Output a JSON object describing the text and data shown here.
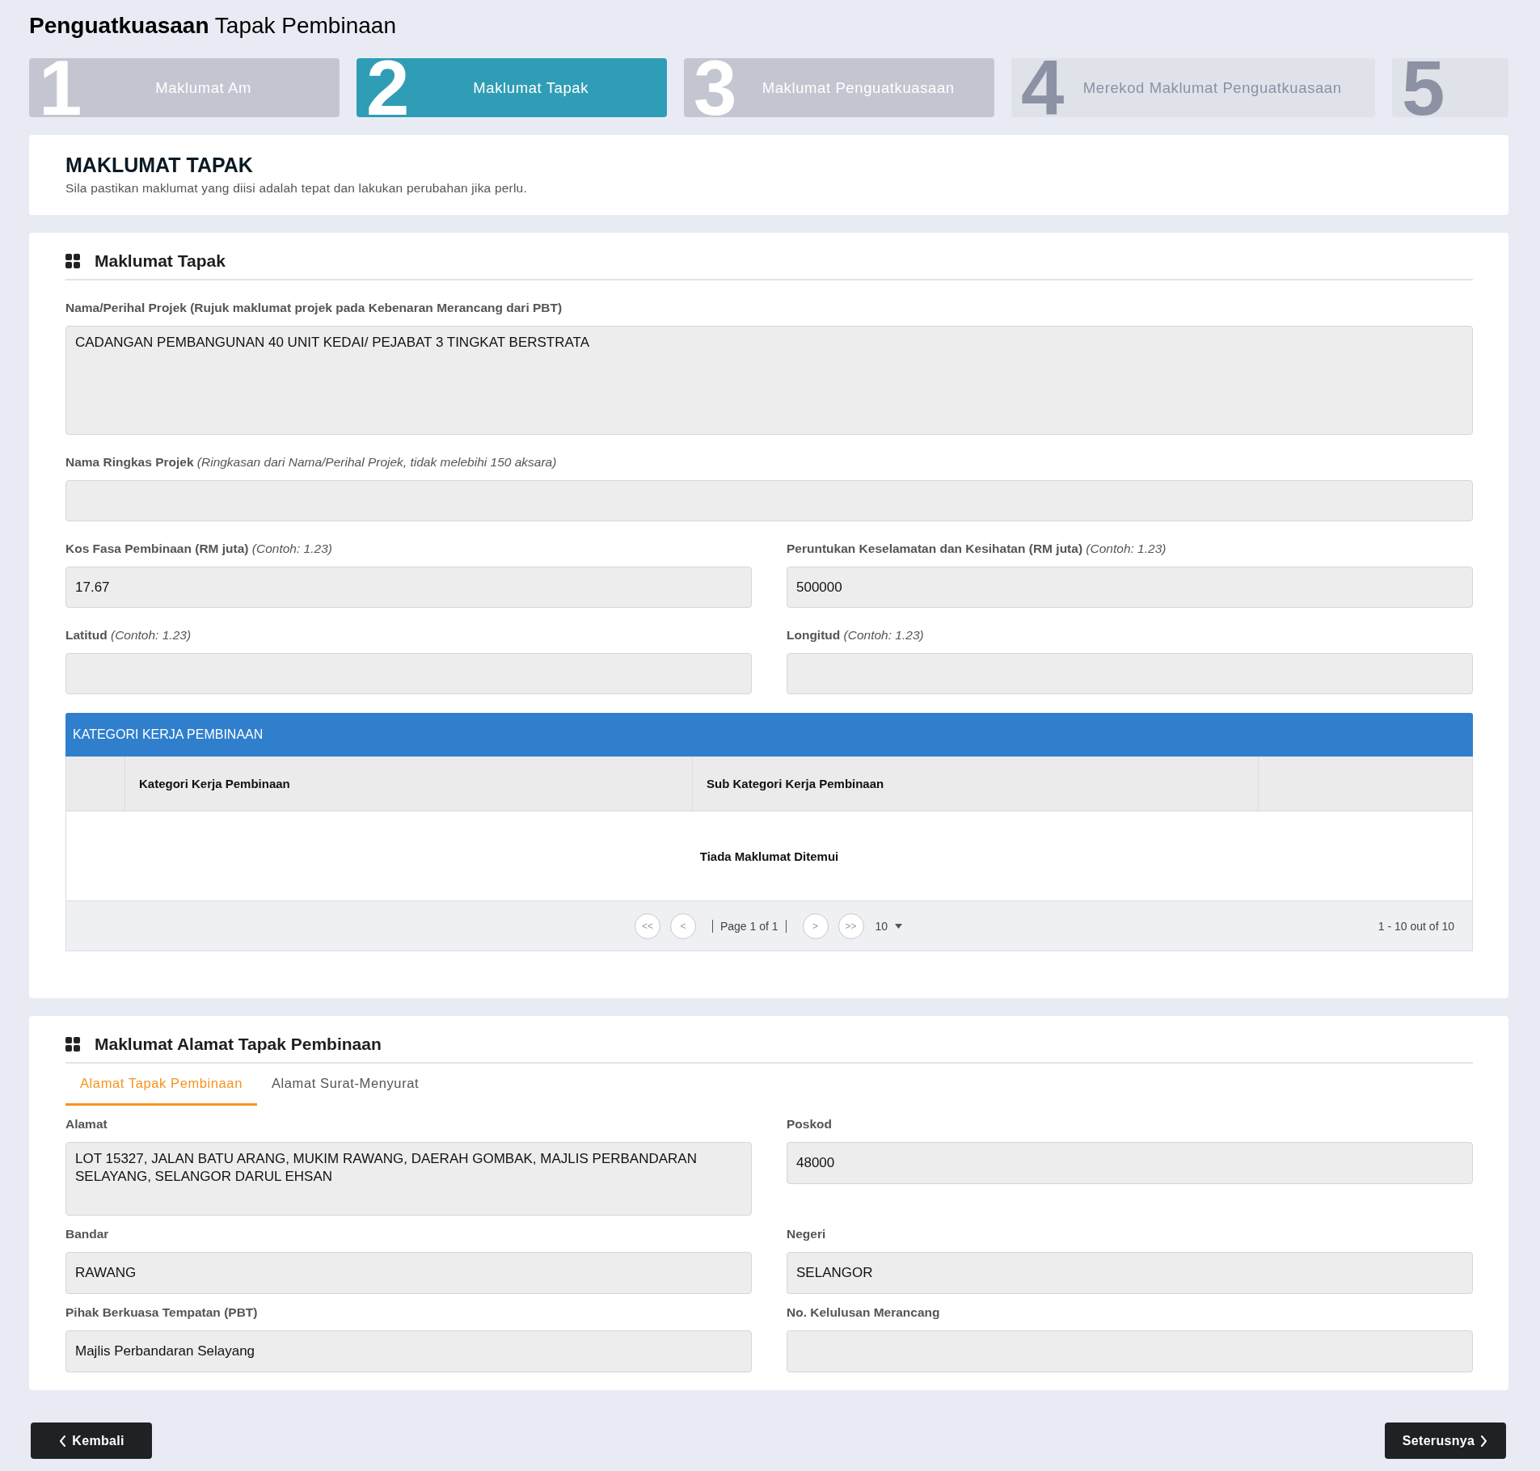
{
  "page_title": "**Penguatkuasaan** Tapak Pembinaan",
  "steps": [
    {
      "number": "1",
      "label": "Maklumat Am",
      "selected": false,
      "disabled": false
    },
    {
      "number": "2",
      "label": "Maklumat Tapak",
      "selected": true,
      "disabled": false
    },
    {
      "number": "3",
      "label": "Maklumat Penguatkuasaan",
      "selected": false,
      "disabled": false
    },
    {
      "number": "4",
      "label": "Merekod Maklumat Penguatkuasaan",
      "selected": false,
      "disabled": true
    },
    {
      "number": "5",
      "selected": false,
      "disabled": true
    }
  ],
  "intro": {
    "title": "MAKLUMAT TAPAK",
    "subtitle": "Sila pastikan maklumat yang diisi adalah tepat dan lakukan perubahan jika perlu."
  },
  "site_section": {
    "heading": "Maklumat Tapak",
    "rows": [
      [
        {
          "label": "Nama/Perihal Projek (Rujuk maklumat projek pada Kebenaran Merancang dari PBT)",
          "kind": "textarea",
          "value": "CADANGAN PEMBANGUNAN 40 UNIT KEDAI/ PEJABAT 3 TINGKAT BERSTRATA"
        }
      ],
      [
        {
          "label": "Nama Ringkas Projek *(Ringkasan dari Nama/Perihal Projek, tidak melebihi 150 aksara)*",
          "kind": "text"
        }
      ],
      [
        {
          "label": "Kos Fasa Pembinaan (RM juta) *(Contoh: 1.23)*",
          "kind": "text",
          "value": "17.67"
        },
        {
          "label": "Peruntukan Keselamatan dan Kesihatan (RM juta) *(Contoh: 1.23)*",
          "kind": "text",
          "value": "500000"
        }
      ],
      [
        {
          "label": "Latitud *(Contoh: 1.23)*",
          "kind": "text"
        },
        {
          "label": "Longitud *(Contoh: 1.23)*",
          "kind": "text"
        }
      ]
    ],
    "table": {
      "title": "KATEGORI KERJA PEMBINAAN",
      "columns": [
        {
          "kind": "blank"
        },
        {
          "kind": "text",
          "label": "Kategori Kerja Pembinaan"
        },
        {
          "kind": "text",
          "label": "Sub Kategori Kerja Pembinaan"
        },
        {
          "kind": "blank"
        }
      ],
      "empty_message": "Tiada Maklumat Ditemui",
      "pagination": {
        "first": "<<",
        "previous": "<",
        "page": "Page 1 of 1",
        "next": ">",
        "last": ">>",
        "page_size": "10",
        "summary": "1 - 10 out of 10"
      }
    }
  },
  "address_section": {
    "heading": "Maklumat Alamat Tapak Pembinaan",
    "tabs": [
      {
        "label": "Alamat Tapak Pembinaan",
        "selected": true
      },
      {
        "label": "Alamat Surat-Menyurat",
        "selected": false
      }
    ],
    "rows": [
      [
        {
          "label": "Alamat",
          "kind": "textarea",
          "value": "LOT 15327, JALAN BATU ARANG, MUKIM RAWANG, DAERAH GOMBAK, MAJLIS PERBANDARAN SELAYANG, SELANGOR DARUL EHSAN"
        },
        {
          "label": "Poskod",
          "kind": "text",
          "value": "48000"
        }
      ],
      [
        {
          "label": "Bandar",
          "kind": "text",
          "value": "RAWANG"
        },
        {
          "label": "Negeri",
          "kind": "text",
          "value": "SELANGOR"
        }
      ],
      [
        {
          "label": "Pihak Berkuasa Tempatan (PBT)",
          "kind": "text",
          "value": "Majlis Perbandaran Selayang"
        },
        {
          "label": "No. Kelulusan Merancang",
          "kind": "text"
        }
      ]
    ]
  },
  "footer_buttons": [
    {
      "label": "Kembali",
      "kind": "back"
    },
    {
      "label": "Seterusnya",
      "kind": "next"
    }
  ]
}
